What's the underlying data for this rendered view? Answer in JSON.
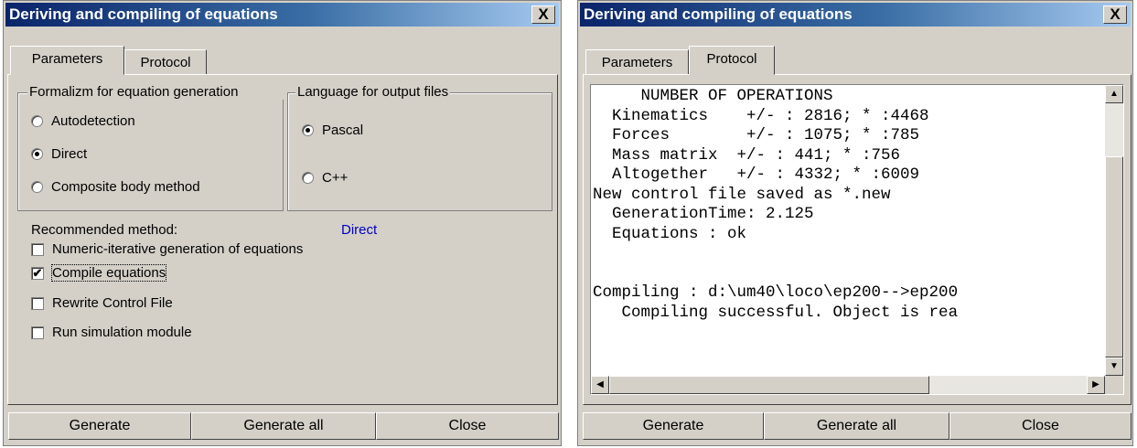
{
  "left_window": {
    "title": "Deriving and compiling of equations",
    "close_glyph": "X",
    "tabs": [
      {
        "label": "Parameters",
        "active": true
      },
      {
        "label": "Protocol",
        "active": false
      }
    ],
    "formalism_group": {
      "legend": "Formalizm for equation generation",
      "options": [
        {
          "label": "Autodetection",
          "selected": false
        },
        {
          "label": "Direct",
          "selected": true
        },
        {
          "label": "Composite body method",
          "selected": false
        }
      ]
    },
    "language_group": {
      "legend": "Language for output files",
      "options": [
        {
          "label": "Pascal",
          "selected": true
        },
        {
          "label": "C++",
          "selected": false
        }
      ]
    },
    "recommended": {
      "label": "Recommended method:",
      "value": "Direct",
      "value_color": "#0000c0"
    },
    "checkboxes": [
      {
        "label": "Numeric-iterative generation of equations",
        "checked": false
      },
      {
        "label": "Compile equations",
        "checked": true
      },
      {
        "label": "Rewrite Control File",
        "checked": false
      },
      {
        "label": "Run simulation module",
        "checked": false
      }
    ],
    "buttons": {
      "generate": "Generate",
      "generate_all": "Generate all",
      "close": "Close"
    }
  },
  "right_window": {
    "title": "Deriving and compiling of equations",
    "close_glyph": "X",
    "tabs": [
      {
        "label": "Parameters",
        "active": false
      },
      {
        "label": "Protocol",
        "active": true
      }
    ],
    "protocol_lines": [
      "     NUMBER OF OPERATIONS",
      "  Kinematics    +/- : 2816; * :4468",
      "  Forces        +/- : 1075; * :785",
      "  Mass matrix  +/- : 441; * :756",
      "  Altogether   +/- : 4332; * :6009",
      "New control file saved as *.new",
      "  GenerationTime: 2.125",
      "  Equations : ok",
      "",
      "",
      "Compiling : d:\\um40\\loco\\ep200-->ep200",
      "   Compiling successful. Object is rea"
    ],
    "buttons": {
      "generate": "Generate",
      "generate_all": "Generate all",
      "close": "Close"
    }
  },
  "icons": {
    "scroll_up": "up-arrow",
    "scroll_down": "down-arrow",
    "scroll_left": "left-arrow",
    "scroll_right": "right-arrow"
  }
}
